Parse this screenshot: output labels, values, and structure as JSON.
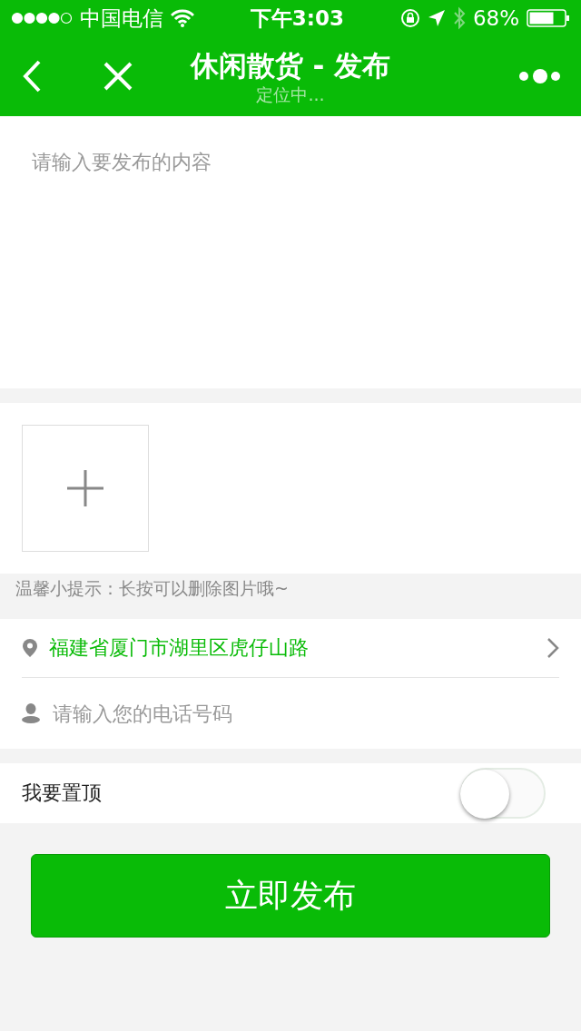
{
  "status_bar": {
    "carrier": "中国电信",
    "time": "下午3:03",
    "battery": "68%"
  },
  "nav": {
    "title": "休闲散货 - 发布",
    "subtitle": "定位中..."
  },
  "content": {
    "placeholder": "请输入要发布的内容"
  },
  "hint": "温馨小提示：长按可以删除图片哦~",
  "location": {
    "value": "福建省厦门市湖里区虎仔山路"
  },
  "phone": {
    "placeholder": "请输入您的电话号码"
  },
  "pin_top": {
    "label": "我要置顶",
    "on": false
  },
  "submit": "立即发布"
}
